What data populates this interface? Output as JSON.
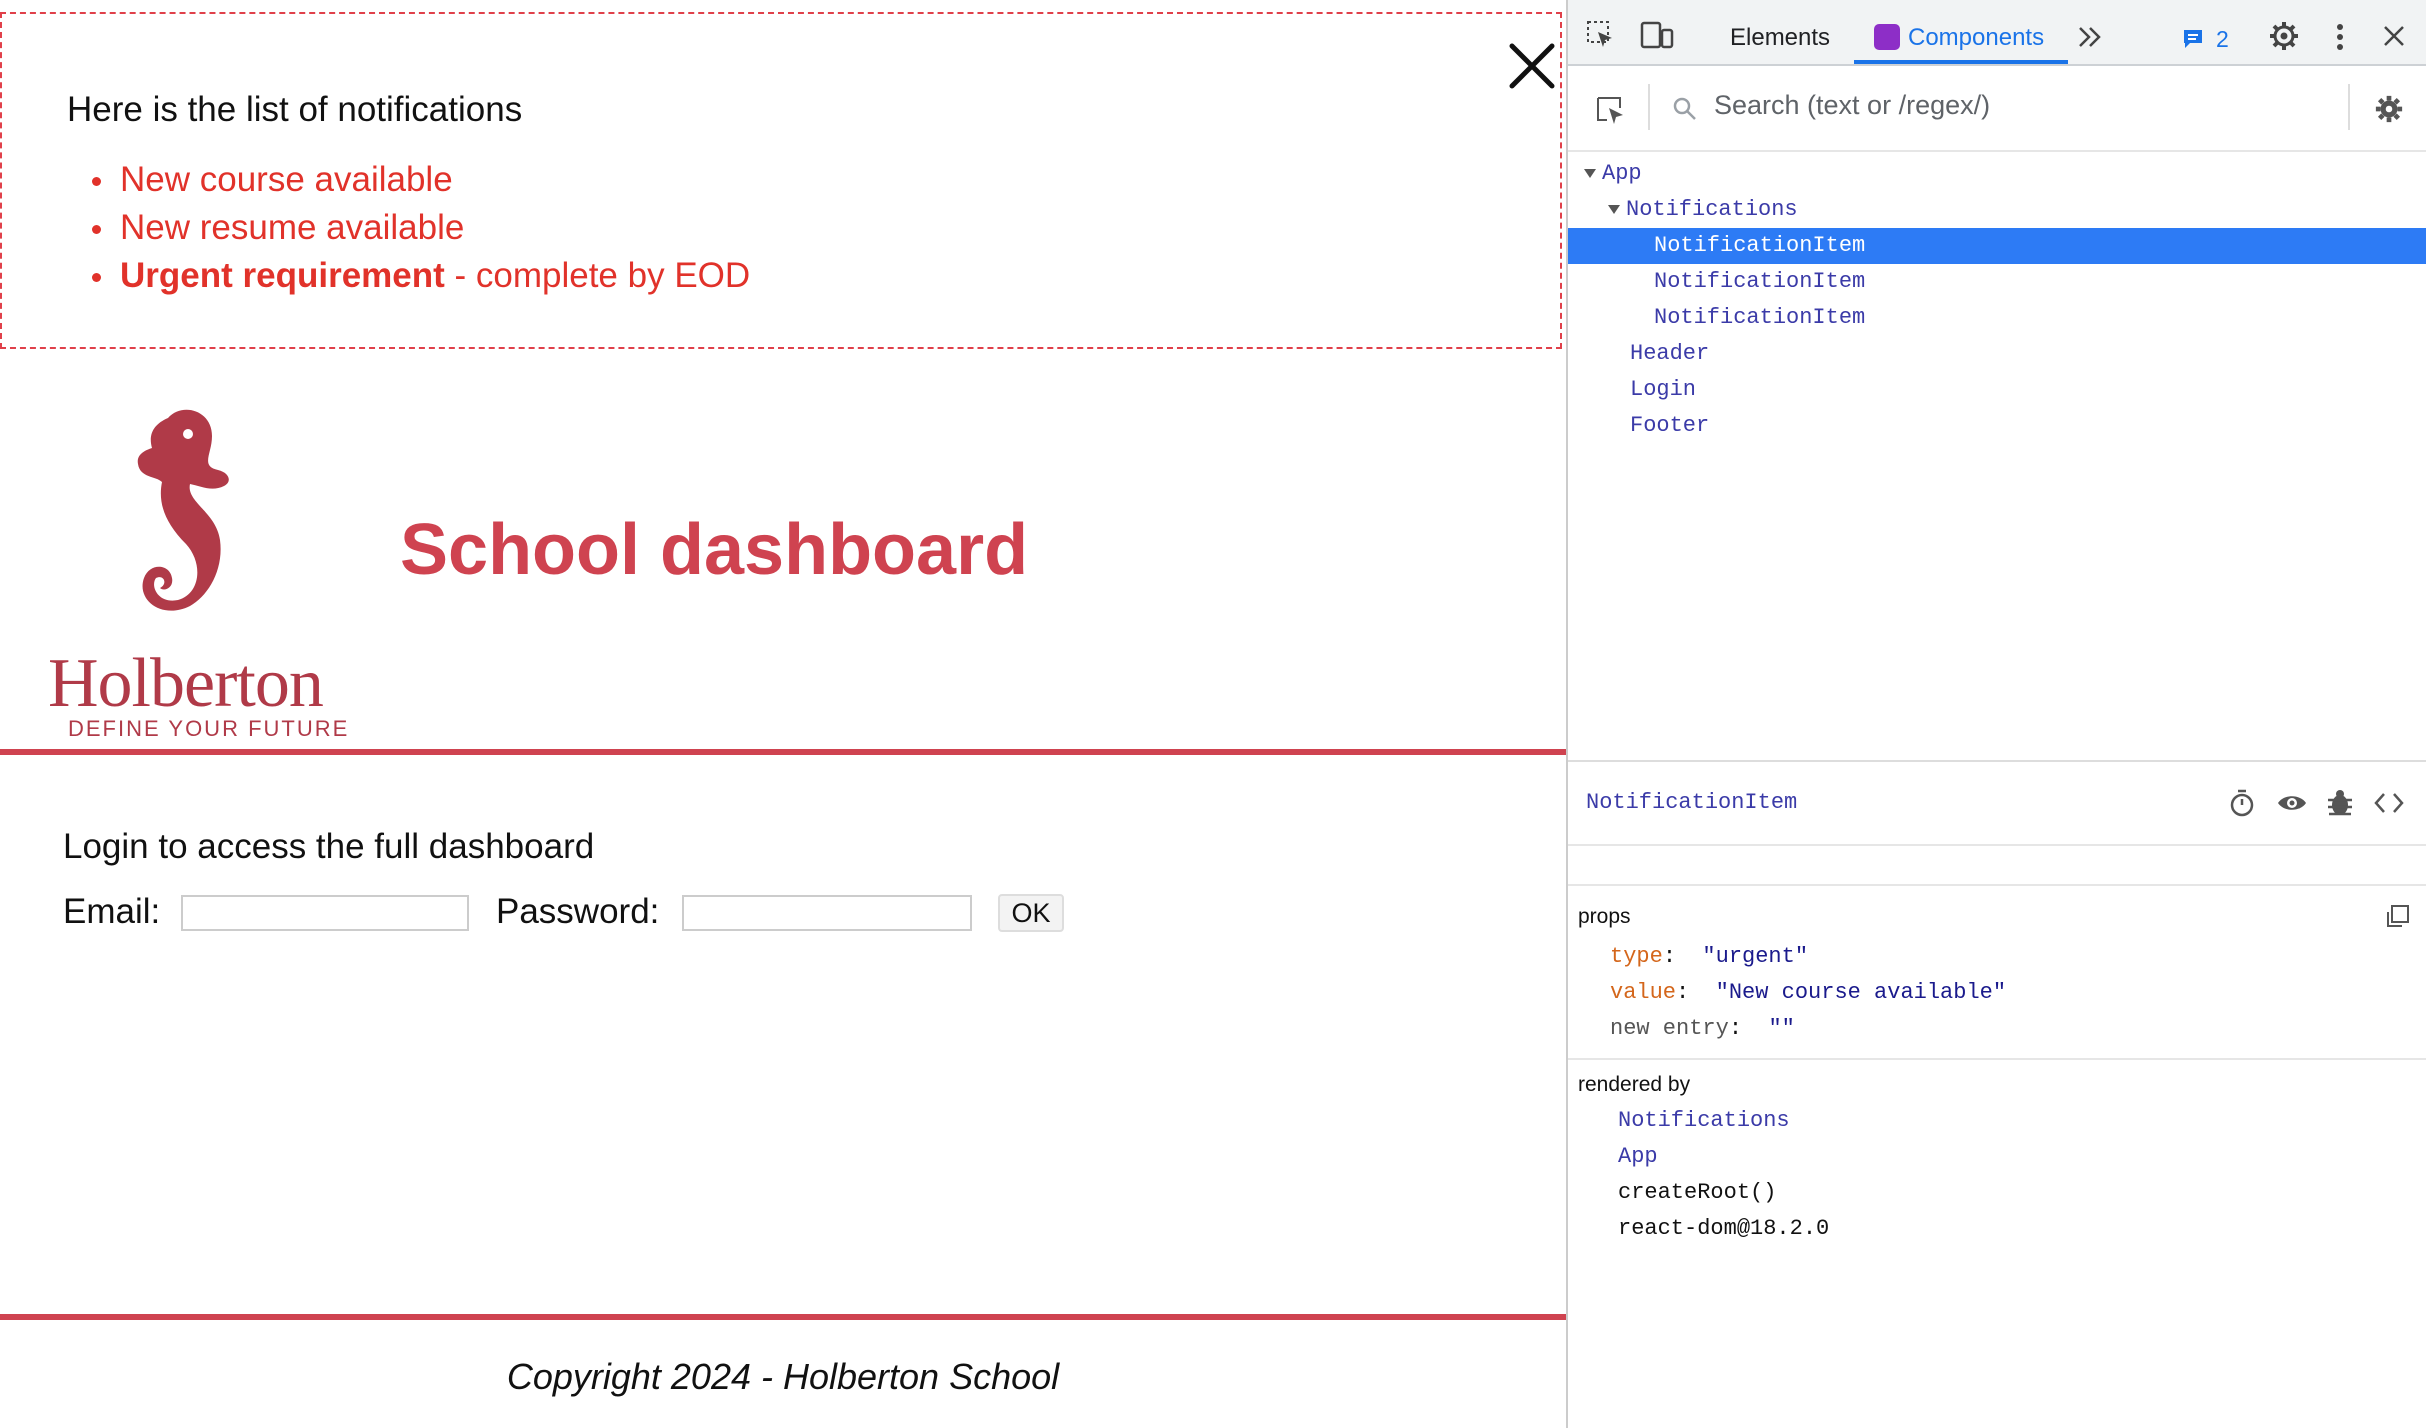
{
  "app": {
    "notifications": {
      "title": "Here is the list of notifications",
      "items": [
        {
          "text": "New course available"
        },
        {
          "text": "New resume available"
        },
        {
          "bold": "Urgent requirement",
          "rest": " - complete by EOD"
        }
      ],
      "close_icon": "close-icon"
    },
    "header": {
      "logo_word": "Holberton",
      "logo_tagline": "DEFINE YOUR FUTURE",
      "title": "School dashboard"
    },
    "login": {
      "heading": "Login to access the full dashboard",
      "email_label": "Email:",
      "email_value": "",
      "password_label": "Password:",
      "password_value": "",
      "submit_label": "OK"
    },
    "footer": {
      "copyright": "Copyright 2024 - Holberton School"
    },
    "colors": {
      "accent": "#cf4350",
      "notif": "#e1322a"
    }
  },
  "devtools": {
    "tabs": {
      "elements": "Elements",
      "components": "Components"
    },
    "message_count": "2",
    "search_placeholder": "Search (text or /regex/)",
    "tree": [
      {
        "label": "App",
        "depth": 0,
        "expanded": true
      },
      {
        "label": "Notifications",
        "depth": 1,
        "expanded": true
      },
      {
        "label": "NotificationItem",
        "depth": 2,
        "selected": true
      },
      {
        "label": "NotificationItem",
        "depth": 2
      },
      {
        "label": "NotificationItem",
        "depth": 2
      },
      {
        "label": "Header",
        "depth": 1
      },
      {
        "label": "Login",
        "depth": 1
      },
      {
        "label": "Footer",
        "depth": 1
      }
    ],
    "selected": {
      "name": "NotificationItem",
      "props_title": "props",
      "props": [
        {
          "key": "type",
          "value": "\"urgent\""
        },
        {
          "key": "value",
          "value": "\"New course available\""
        },
        {
          "key": "new entry",
          "value": "\"\""
        }
      ],
      "rendered_by_title": "rendered by",
      "rendered_by": [
        {
          "label": "Notifications",
          "kind": "component"
        },
        {
          "label": "App",
          "kind": "component"
        },
        {
          "label": "createRoot()",
          "kind": "plain"
        },
        {
          "label": "react-dom@18.2.0",
          "kind": "plain"
        }
      ]
    }
  }
}
